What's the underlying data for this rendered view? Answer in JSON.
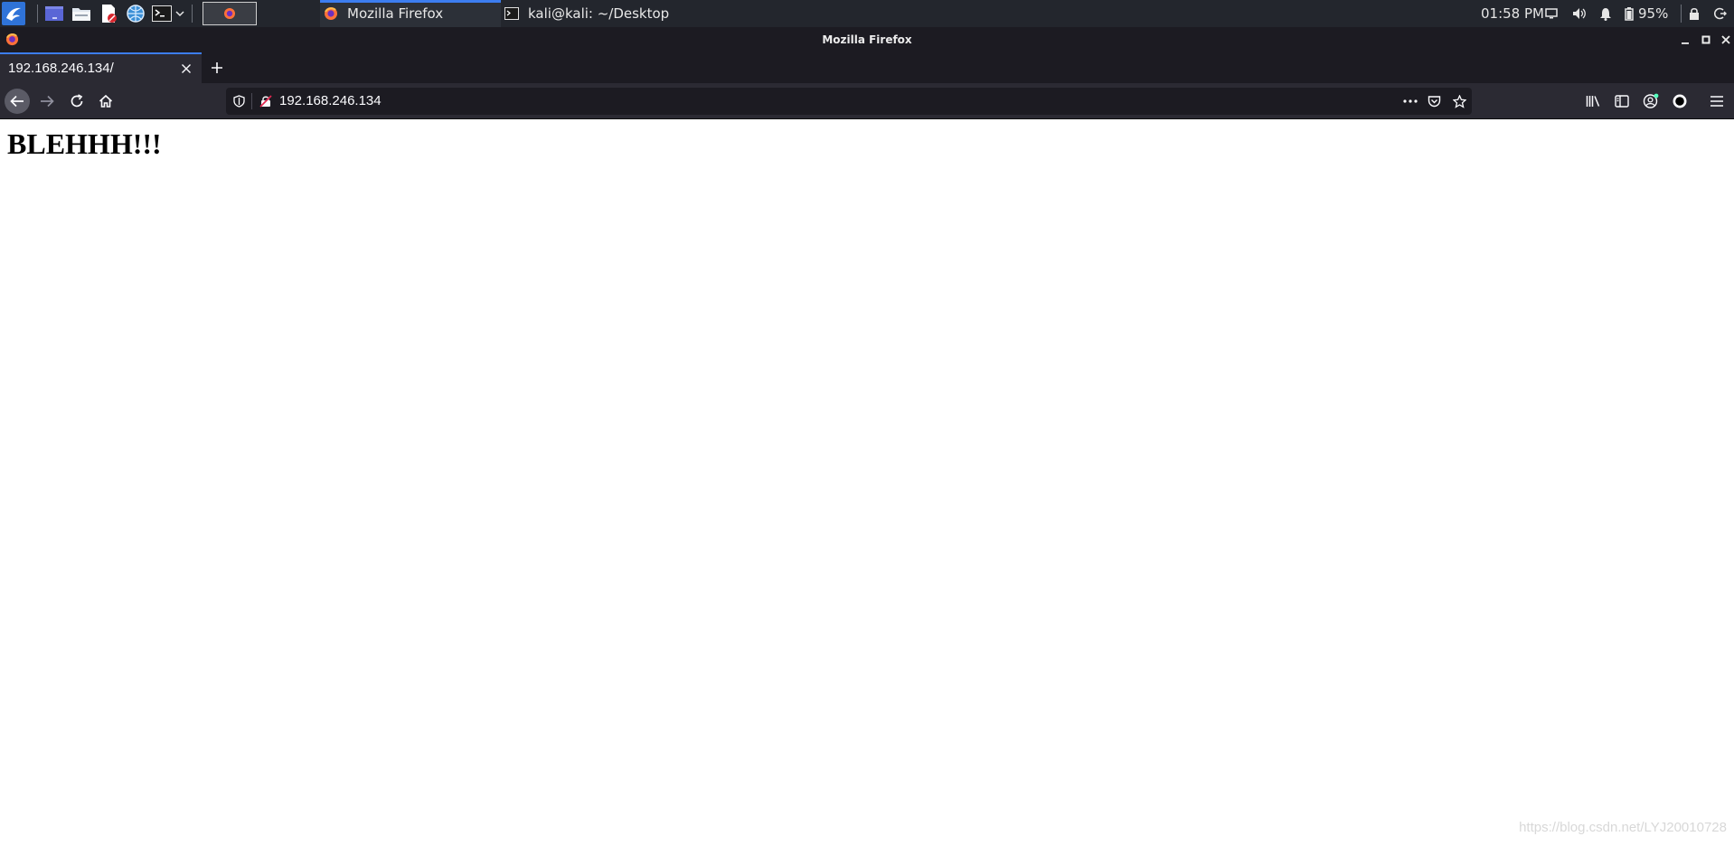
{
  "panel": {
    "taskbar": {
      "firefox_window_label": "Mozilla Firefox",
      "terminal_window_label": "kali@kali: ~/Desktop"
    },
    "tray": {
      "clock": "01:58 PM",
      "battery_percent": "95%"
    }
  },
  "window": {
    "title": "Mozilla Firefox"
  },
  "tabs": [
    {
      "title": "192.168.246.134/",
      "active": true
    }
  ],
  "navbar": {
    "url": "192.168.246.134"
  },
  "page": {
    "heading": "BLEHHH!!!",
    "watermark": "https://blog.csdn.net/LYJ20010728"
  },
  "colors": {
    "accent": "#3c7df0",
    "panel_bg": "#23262d",
    "toolbar_bg": "#2b2a33",
    "titlebar_bg": "#1c1b22"
  },
  "icons": {
    "menu": "kali-dragon-icon",
    "launchers": [
      "workspace-icon",
      "file-manager-icon",
      "text-editor-icon",
      "network-icon",
      "terminal-icon"
    ],
    "tray": [
      "display-icon",
      "volume-icon",
      "notification-bell-icon",
      "battery-icon",
      "lock-icon",
      "logout-icon"
    ]
  }
}
